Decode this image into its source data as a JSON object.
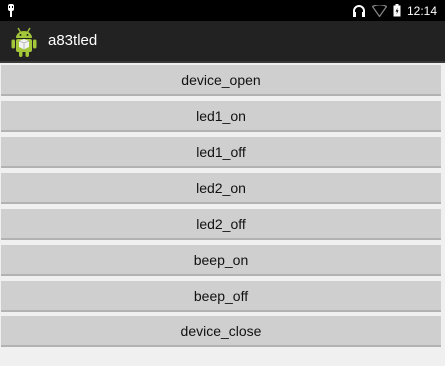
{
  "status_bar": {
    "time": "12:14",
    "icons": [
      "usb-icon",
      "headphones-icon",
      "wifi-icon",
      "battery-icon"
    ]
  },
  "action_bar": {
    "app_icon": "android-icon",
    "title": "a83tled"
  },
  "buttons": [
    {
      "label": "device_open"
    },
    {
      "label": "led1_on"
    },
    {
      "label": "led1_off"
    },
    {
      "label": "led2_on"
    },
    {
      "label": "led2_off"
    },
    {
      "label": "beep_on"
    },
    {
      "label": "beep_off"
    },
    {
      "label": "device_close"
    }
  ],
  "colors": {
    "status_bar": "#000000",
    "action_bar": "#222222",
    "button": "#cfcfcf",
    "background": "#f0f0f0",
    "android_green": "#a4c639"
  }
}
